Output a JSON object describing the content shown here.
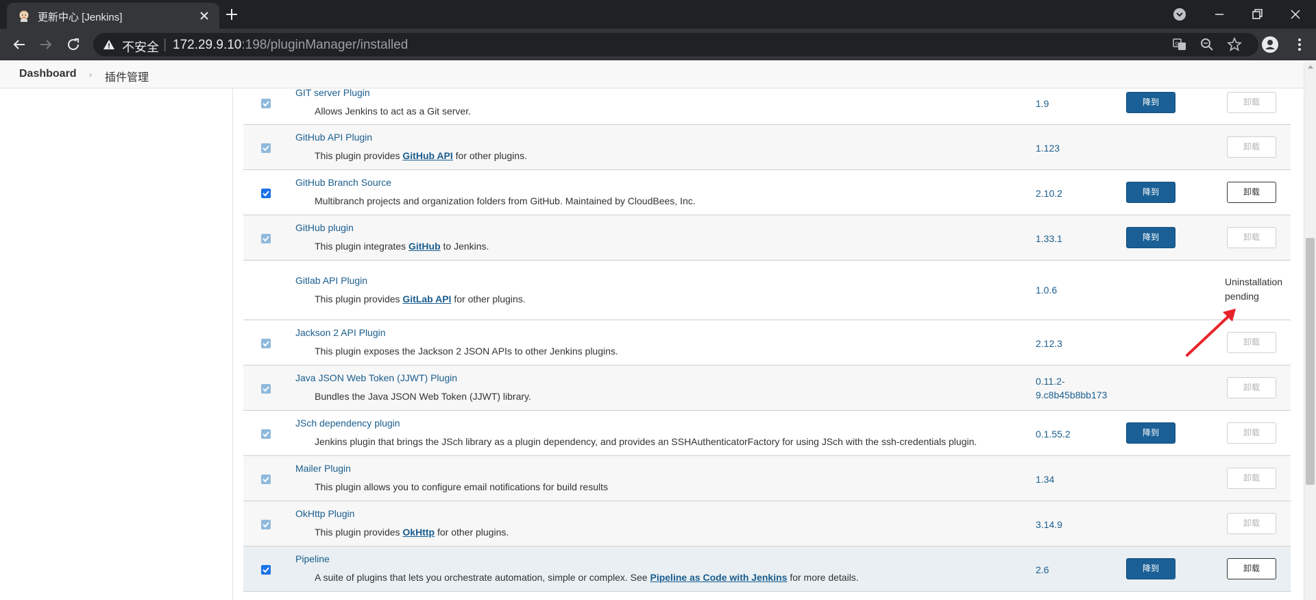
{
  "browser": {
    "tab_title": "更新中心 [Jenkins]",
    "omnibox": {
      "security_label": "不安全",
      "url_host": "172.29.9.10",
      "url_rest": ":198/pluginManager/installed"
    }
  },
  "breadcrumb": {
    "items": [
      "Dashboard",
      "插件管理"
    ]
  },
  "labels": {
    "downgrade": "降到",
    "uninstall": "卸载",
    "pending_line1": "Uninstallation",
    "pending_line2": "pending"
  },
  "plugins": [
    {
      "name": "GIT server Plugin",
      "desc": "Allows Jenkins to act as a Git server.",
      "version": "1.9",
      "enabled": true,
      "checkbox_editable": false,
      "downgrade": true,
      "uninstall_enabled": false
    },
    {
      "name": "GitHub API Plugin",
      "desc_before": "This plugin provides ",
      "desc_link": "GitHub API",
      "desc_after": " for other plugins.",
      "version": "1.123",
      "enabled": true,
      "checkbox_editable": false,
      "downgrade": false,
      "uninstall_enabled": false
    },
    {
      "name": "GitHub Branch Source",
      "desc": "Multibranch projects and organization folders from GitHub. Maintained by CloudBees, Inc.",
      "version": "2.10.2",
      "enabled": true,
      "checkbox_editable": true,
      "downgrade": true,
      "uninstall_enabled": true
    },
    {
      "name": "GitHub plugin",
      "desc_before": "This plugin integrates ",
      "desc_link": "GitHub",
      "desc_after": " to Jenkins.",
      "version": "1.33.1",
      "enabled": true,
      "checkbox_editable": false,
      "downgrade": true,
      "uninstall_enabled": false
    },
    {
      "name": "Gitlab API Plugin",
      "desc_before": "This plugin provides ",
      "desc_link": "GitLab API",
      "desc_after": " for other plugins.",
      "version": "1.0.6",
      "status": "Uninstallation pending"
    },
    {
      "name": "Jackson 2 API Plugin",
      "desc": "This plugin exposes the Jackson 2 JSON APIs to other Jenkins plugins.",
      "version": "2.12.3",
      "enabled": true,
      "checkbox_editable": false,
      "downgrade": false,
      "uninstall_enabled": false
    },
    {
      "name": "Java JSON Web Token (JJWT) Plugin",
      "desc": "Bundles the Java JSON Web Token (JJWT) library.",
      "version_line1": "0.11.2-",
      "version_line2": "9.c8b45b8bb173",
      "enabled": true,
      "checkbox_editable": false,
      "downgrade": false,
      "uninstall_enabled": false
    },
    {
      "name": "JSch dependency plugin",
      "desc": "Jenkins plugin that brings the JSch library as a plugin dependency, and provides an SSHAuthenticatorFactory for using JSch with the ssh-credentials plugin.",
      "version": "0.1.55.2",
      "enabled": true,
      "checkbox_editable": false,
      "downgrade": true,
      "uninstall_enabled": false
    },
    {
      "name": "Mailer Plugin",
      "desc": "This plugin allows you to configure email notifications for build results",
      "version": "1.34",
      "enabled": true,
      "checkbox_editable": false,
      "downgrade": false,
      "uninstall_enabled": false
    },
    {
      "name": "OkHttp Plugin",
      "desc_before": "This plugin provides ",
      "desc_link": "OkHttp",
      "desc_after": " for other plugins.",
      "version": "3.14.9",
      "enabled": true,
      "checkbox_editable": false,
      "downgrade": false,
      "uninstall_enabled": false
    },
    {
      "name": "Pipeline",
      "desc_before": "A suite of plugins that lets you orchestrate automation, simple or complex. See ",
      "desc_link": "Pipeline as Code with Jenkins",
      "desc_after": " for more details.",
      "version": "2.6",
      "enabled": true,
      "checkbox_editable": true,
      "downgrade": true,
      "uninstall_enabled": true
    }
  ],
  "colors": {
    "jenkins_link": "#1a5d8e",
    "downgrade_button": "#1a5f95",
    "annotation_arrow": "#e8242a"
  }
}
